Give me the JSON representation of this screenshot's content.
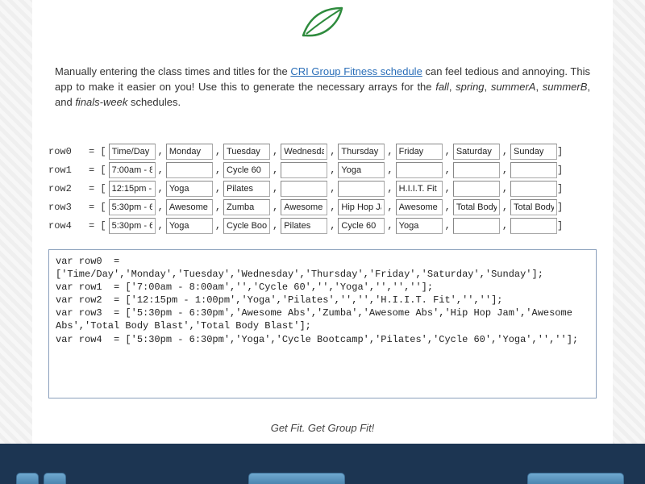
{
  "intro": {
    "pre_link": "Manually entering the class times and titles for the ",
    "link_text": "CRI Group Fitness schedule",
    "post_link": " can feel tedious and annoying. This app to make it easier on you! Use this to generate the necessary arrays for the ",
    "terms": [
      "fall",
      "spring",
      "summerA",
      "summerB",
      "finals-week"
    ],
    "terms_tail": " schedules."
  },
  "rows": [
    {
      "label": "row0",
      "cells": [
        "Time/Day",
        "Monday",
        "Tuesday",
        "Wednesday",
        "Thursday",
        "Friday",
        "Saturday",
        "Sunday"
      ]
    },
    {
      "label": "row1",
      "cells": [
        "7:00am - 8:00am",
        "",
        "Cycle 60",
        "",
        "Yoga",
        "",
        "",
        ""
      ]
    },
    {
      "label": "row2",
      "cells": [
        "12:15pm - 1:00pm",
        "Yoga",
        "Pilates",
        "",
        "",
        "H.I.I.T. Fit",
        "",
        ""
      ]
    },
    {
      "label": "row3",
      "cells": [
        "5:30pm - 6:30pm",
        "Awesome Abs",
        "Zumba",
        "Awesome Abs",
        "Hip Hop Jam",
        "Awesome Abs",
        "Total Body Blast",
        "Total Body Blast"
      ]
    },
    {
      "label": "row4",
      "cells": [
        "5:30pm - 6:30pm",
        "Yoga",
        "Cycle Bootcamp",
        "Pilates",
        "Cycle 60",
        "Yoga",
        "",
        ""
      ]
    }
  ],
  "code_output": "var row0  = ['Time/Day','Monday','Tuesday','Wednesday','Thursday','Friday','Saturday','Sunday'];\nvar row1  = ['7:00am - 8:00am','','Cycle 60','','Yoga','','',''];\nvar row2  = ['12:15pm - 1:00pm','Yoga','Pilates','','','H.I.I.T. Fit','',''];\nvar row3  = ['5:30pm - 6:30pm','Awesome Abs','Zumba','Awesome Abs','Hip Hop Jam','Awesome Abs','Total Body Blast','Total Body Blast'];\nvar row4  = ['5:30pm - 6:30pm','Yoga','Cycle Bootcamp','Pilates','Cycle 60','Yoga','',''];",
  "tagline": "Get Fit. Get Group Fit!"
}
